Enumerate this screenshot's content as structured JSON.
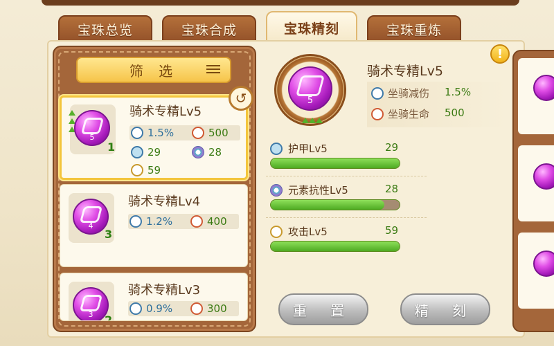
{
  "tabs": [
    {
      "label": "宝珠总览",
      "active": false
    },
    {
      "label": "宝珠合成",
      "active": false
    },
    {
      "label": "宝珠精刻",
      "active": true
    },
    {
      "label": "宝珠重炼",
      "active": false
    }
  ],
  "filter": {
    "label": "筛 选",
    "icon": "list-icon"
  },
  "info_icon": "!",
  "reset_icon": "↺",
  "cards": [
    {
      "title": "骑术专精Lv5",
      "gem_level": "5",
      "count": "1",
      "selected": true,
      "stats": [
        {
          "icon": "mount-icon",
          "value": "1.5%"
        },
        {
          "icon": "life-icon",
          "value": "500"
        },
        {
          "icon": "armor-icon",
          "value": "29"
        },
        {
          "icon": "element-icon",
          "value": "28"
        },
        {
          "icon": "attack-icon",
          "value": "59"
        }
      ]
    },
    {
      "title": "骑术专精Lv4",
      "gem_level": "4",
      "count": "3",
      "selected": false,
      "stats": [
        {
          "icon": "mount-icon",
          "value": "1.2%"
        },
        {
          "icon": "life-icon",
          "value": "400"
        }
      ]
    },
    {
      "title": "骑术专精Lv3",
      "gem_level": "3",
      "count": "2",
      "selected": false,
      "stats": [
        {
          "icon": "mount-icon",
          "value": "0.9%"
        },
        {
          "icon": "life-icon",
          "value": "300"
        }
      ]
    }
  ],
  "detail": {
    "title": "骑术专精Lv5",
    "gem_level": "5",
    "base_stats": [
      {
        "label": "坐骑减伤",
        "value": "1.5%",
        "icon": "mount-icon"
      },
      {
        "label": "坐骑生命",
        "value": "500",
        "icon": "life-icon"
      }
    ],
    "engrave_stats": [
      {
        "label": "护甲Lv5",
        "value": "29",
        "icon": "armor-icon",
        "progress": 1.0
      },
      {
        "label": "元素抗性Lv5",
        "value": "28",
        "icon": "element-icon",
        "progress": 0.88
      },
      {
        "label": "攻击Lv5",
        "value": "59",
        "icon": "attack-icon",
        "progress": 1.0
      }
    ]
  },
  "buttons": {
    "reset": "重 置",
    "engrave": "精 刻"
  },
  "colors": {
    "accent": "#f3c53c",
    "brown": "#a4663a",
    "green": "#4eaa22",
    "gem": "#e04de6"
  }
}
